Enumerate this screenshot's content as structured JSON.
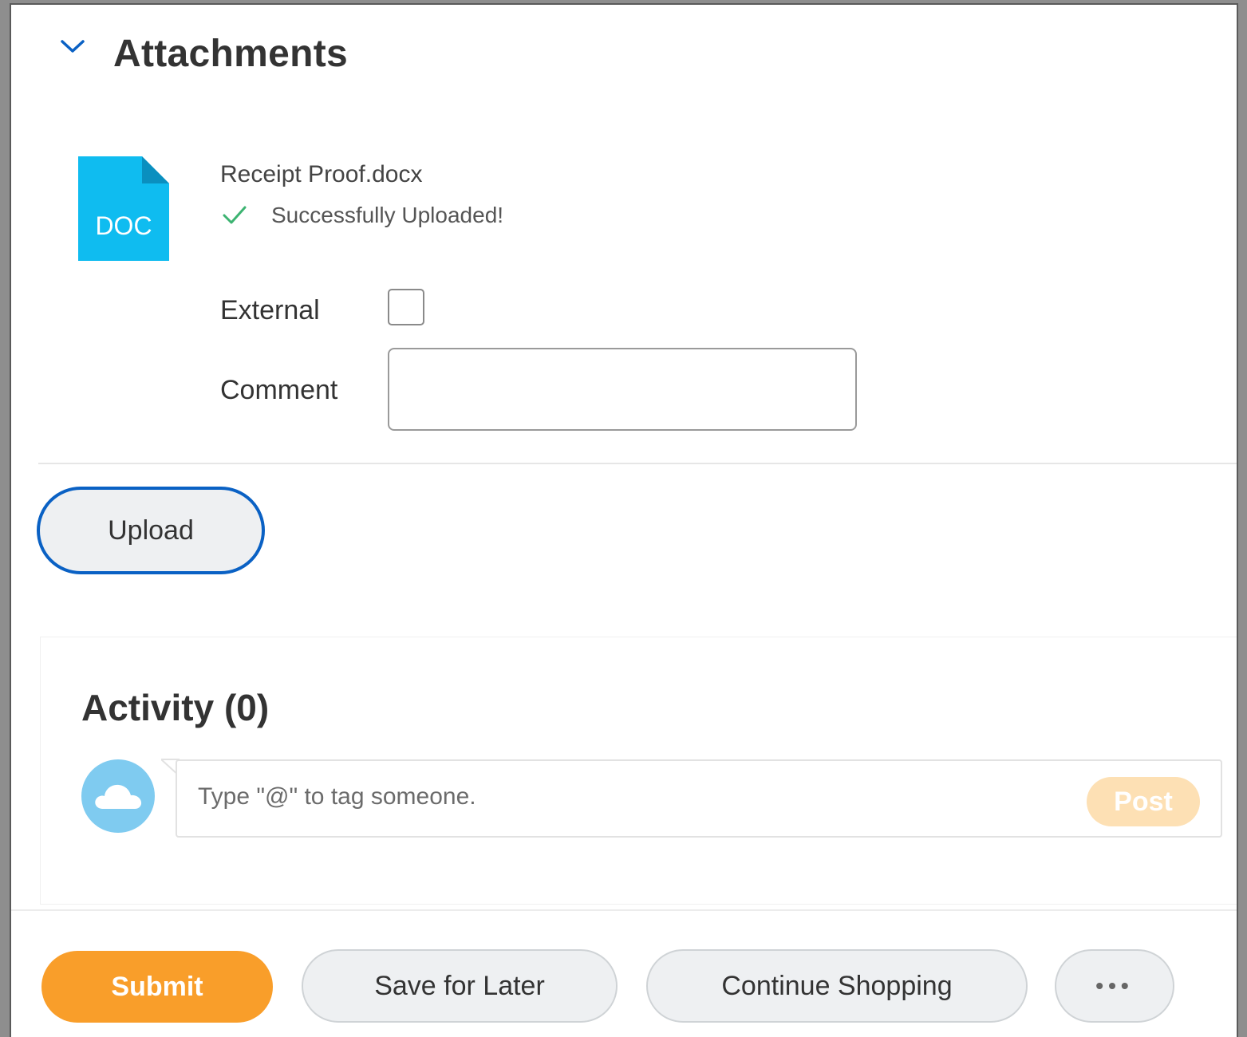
{
  "section": {
    "title": "Attachments",
    "collapse_icon": "chevron-down-icon"
  },
  "attachment": {
    "file_type_label": "DOC",
    "file_name": "Receipt Proof.docx",
    "status_text": "Successfully Uploaded!",
    "status_icon": "check-icon",
    "icon_color": "#0fbcf0"
  },
  "form": {
    "external_label": "External",
    "external_checked": false,
    "comment_label": "Comment",
    "comment_value": ""
  },
  "upload_button": {
    "label": "Upload"
  },
  "activity": {
    "title": "Activity (0)",
    "avatar_icon": "cloud-icon",
    "comment_placeholder": "Type \"@\" to tag someone.",
    "post_label": "Post"
  },
  "footer": {
    "submit_label": "Submit",
    "save_label": "Save for Later",
    "continue_label": "Continue Shopping",
    "more_label": "•••"
  },
  "colors": {
    "accent_blue": "#0a61c4",
    "submit_orange": "#f99e2a",
    "post_disabled": "#fde0b4",
    "success_green": "#3cb371"
  }
}
